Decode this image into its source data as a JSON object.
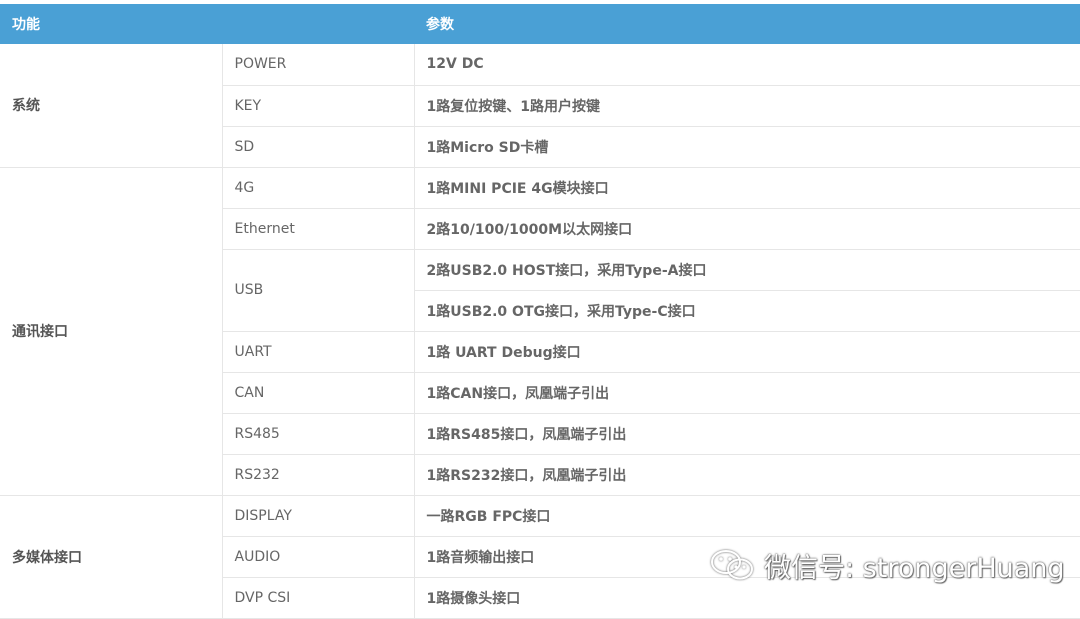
{
  "header": {
    "col1": "功能",
    "col3": "参数"
  },
  "groups": {
    "system": "系统",
    "comm": "通讯接口",
    "media": "多媒体接口"
  },
  "rows": [
    {
      "item": "POWER",
      "value": "12V DC"
    },
    {
      "item": "KEY",
      "value": "1路复位按键、1路用户按键"
    },
    {
      "item": "SD",
      "value": "1路Micro SD卡槽"
    },
    {
      "item": "4G",
      "value": "1路MINI PCIE 4G模块接口"
    },
    {
      "item": "Ethernet",
      "value": "2路10/100/1000M以太网接口"
    },
    {
      "item": "USB",
      "value": "2路USB2.0 HOST接口，采用Type-A接口"
    },
    {
      "item": "",
      "value": "1路USB2.0 OTG接口，采用Type-C接口"
    },
    {
      "item": "UART",
      "value": "1路 UART Debug接口"
    },
    {
      "item": "CAN",
      "value": "1路CAN接口，凤凰端子引出"
    },
    {
      "item": "RS485",
      "value": "1路RS485接口，凤凰端子引出"
    },
    {
      "item": "RS232",
      "value": "1路RS232接口，凤凰端子引出"
    },
    {
      "item": "DISPLAY",
      "value": "一路RGB FPC接口"
    },
    {
      "item": "AUDIO",
      "value": "1路音频输出接口"
    },
    {
      "item": "DVP CSI",
      "value": "1路摄像头接口"
    }
  ],
  "watermark": {
    "text": "微信号: strongerHuang",
    "icon": "wechat-icon"
  }
}
